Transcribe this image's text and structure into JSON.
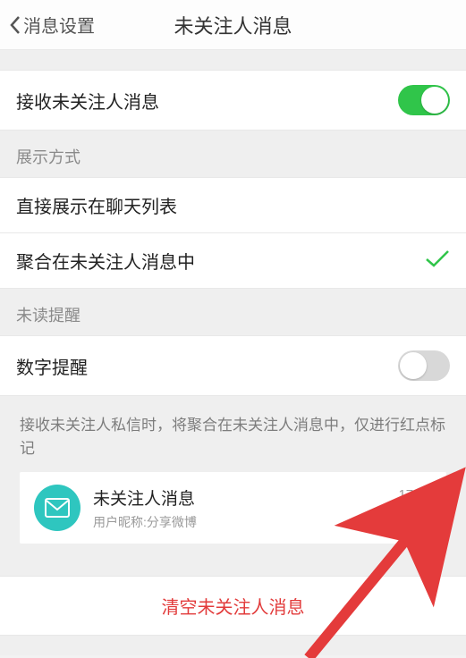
{
  "header": {
    "back_label": "消息设置",
    "title": "未关注人消息"
  },
  "receive": {
    "label": "接收未关注人消息",
    "on": true
  },
  "display_section": {
    "header": "展示方式",
    "option_direct": "直接展示在聊天列表",
    "option_aggregate": "聚合在未关注人消息中",
    "selected": "aggregate"
  },
  "unread_section": {
    "header": "未读提醒",
    "number_label": "数字提醒",
    "number_on": false
  },
  "info": {
    "text": "接收未关注人私信时，将聚合在未关注人消息中，仅进行红点标记",
    "card": {
      "title": "未关注人消息",
      "subtitle": "用户昵称:分享微博",
      "time": "17:43"
    }
  },
  "clear": {
    "label": "清空未关注人消息"
  }
}
